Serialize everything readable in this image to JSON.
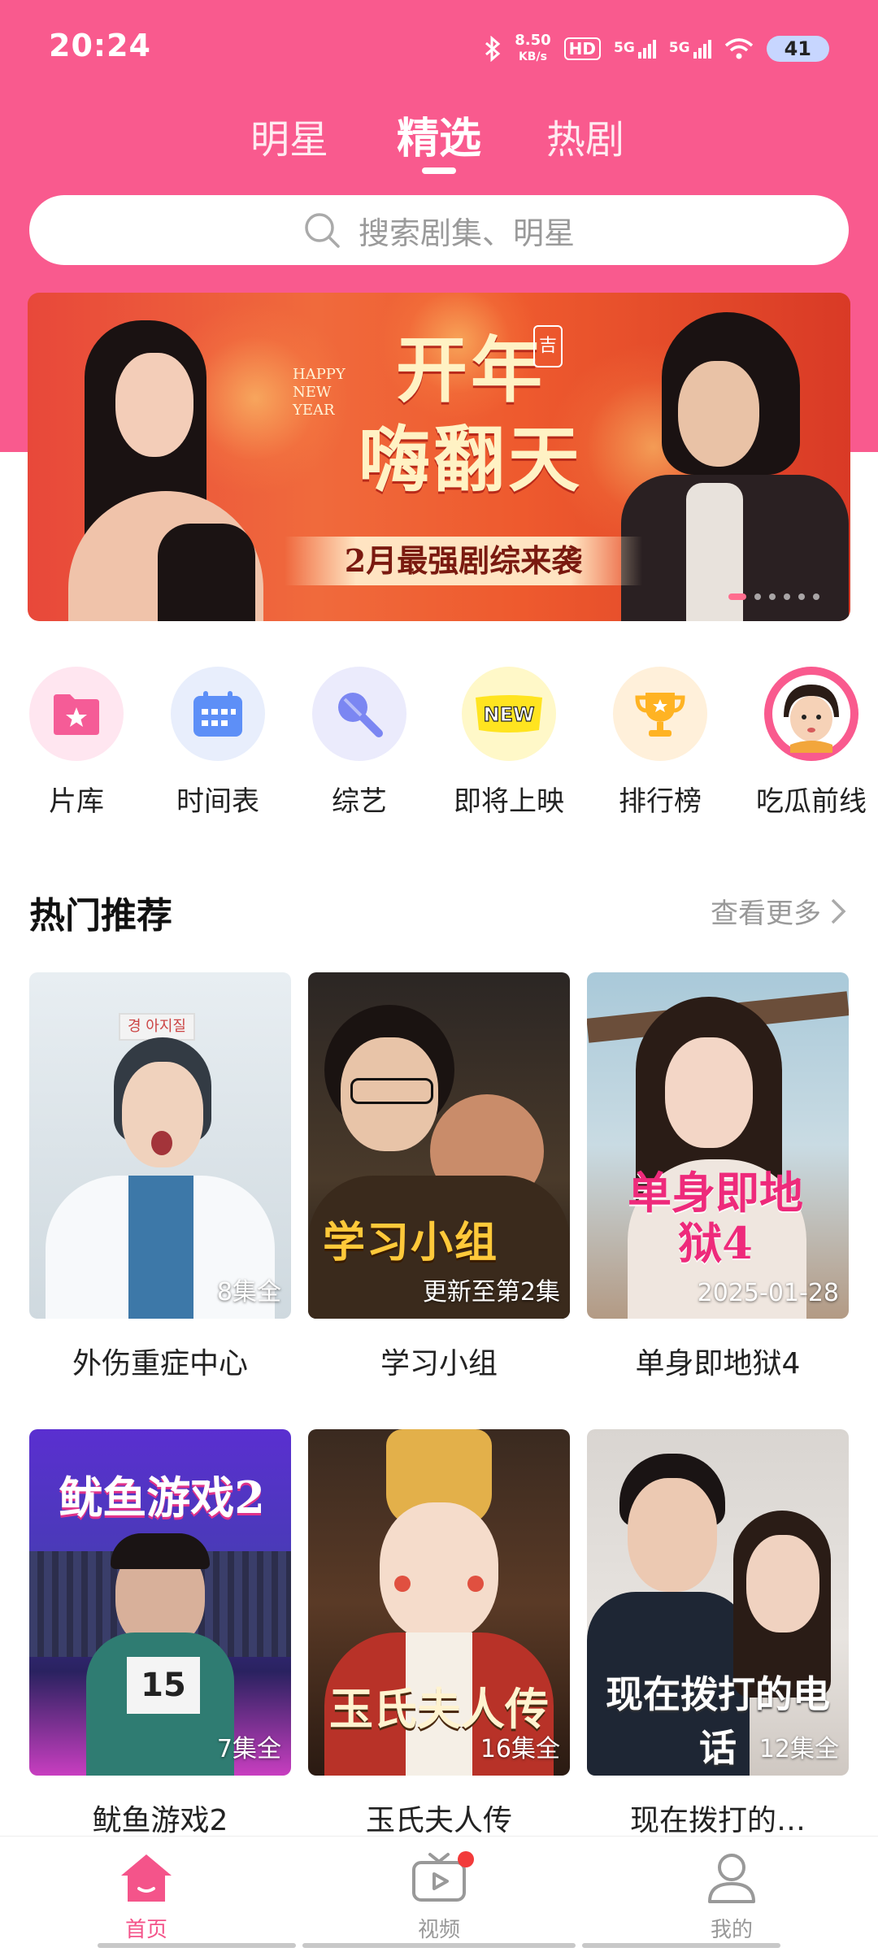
{
  "status_bar": {
    "time": "20:24",
    "net_speed_value": "8.50",
    "net_speed_unit": "KB/s",
    "hd_label": "HD",
    "sim1_label": "5G",
    "sim2_label": "5G",
    "battery": "41",
    "icons": [
      "bluetooth-icon",
      "hd-icon",
      "signal-icon",
      "signal-icon",
      "wifi-icon",
      "battery-icon"
    ]
  },
  "top_tabs": [
    {
      "label": "明星",
      "active": false
    },
    {
      "label": "精选",
      "active": true
    },
    {
      "label": "热剧",
      "active": false
    }
  ],
  "search": {
    "placeholder": "搜索剧集、明星",
    "icon": "search-icon"
  },
  "banner": {
    "english": "HAPPY NEW YEAR",
    "headline_line1": "开年",
    "headline_line2": "嗨翻天",
    "seal": "吉",
    "subtitle": "2月最强剧综来袭",
    "page_count": 6,
    "current_page": 1
  },
  "shortcuts": [
    {
      "label": "片库",
      "icon": "folder-star-icon",
      "bg": "#ffe6f0"
    },
    {
      "label": "时间表",
      "icon": "calendar-icon",
      "bg": "#e8eefc"
    },
    {
      "label": "综艺",
      "icon": "microphone-icon",
      "bg": "#ebebfc"
    },
    {
      "label": "即将上映",
      "icon": "new-badge-icon",
      "bg": "#fff8c8"
    },
    {
      "label": "排行榜",
      "icon": "trophy-icon",
      "bg": "#fff0da"
    },
    {
      "label": "吃瓜前线",
      "icon": "doll-avatar-icon",
      "bg": "#f95a8e"
    }
  ],
  "section": {
    "title": "热门推荐",
    "more_label": "查看更多"
  },
  "cards": [
    {
      "title": "外伤重症中心",
      "badge": "8集全",
      "poster_text": ""
    },
    {
      "title": "学习小组",
      "badge": "更新至第2集",
      "poster_text": "学习小组"
    },
    {
      "title": "单身即地狱4",
      "badge": "2025-01-28",
      "poster_text": "单身即地狱4"
    },
    {
      "title": "鱿鱼游戏2",
      "badge": "7集全",
      "poster_text": "鱿鱼游戏2"
    },
    {
      "title": "玉氏夫人传",
      "badge": "16集全",
      "poster_text": "玉氏夫人传"
    },
    {
      "title": "现在拨打的…",
      "badge": "12集全",
      "poster_text": "现在拨打的电话"
    }
  ],
  "bottom_nav": [
    {
      "label": "首页",
      "icon": "home-icon",
      "active": true
    },
    {
      "label": "视频",
      "icon": "tv-play-icon",
      "active": false,
      "has_dot": true
    },
    {
      "label": "我的",
      "icon": "profile-icon",
      "active": false
    }
  ],
  "colors": {
    "brand": "#f95a8e",
    "active_nav": "#f4548a",
    "notify_dot": "#f23b3b"
  }
}
